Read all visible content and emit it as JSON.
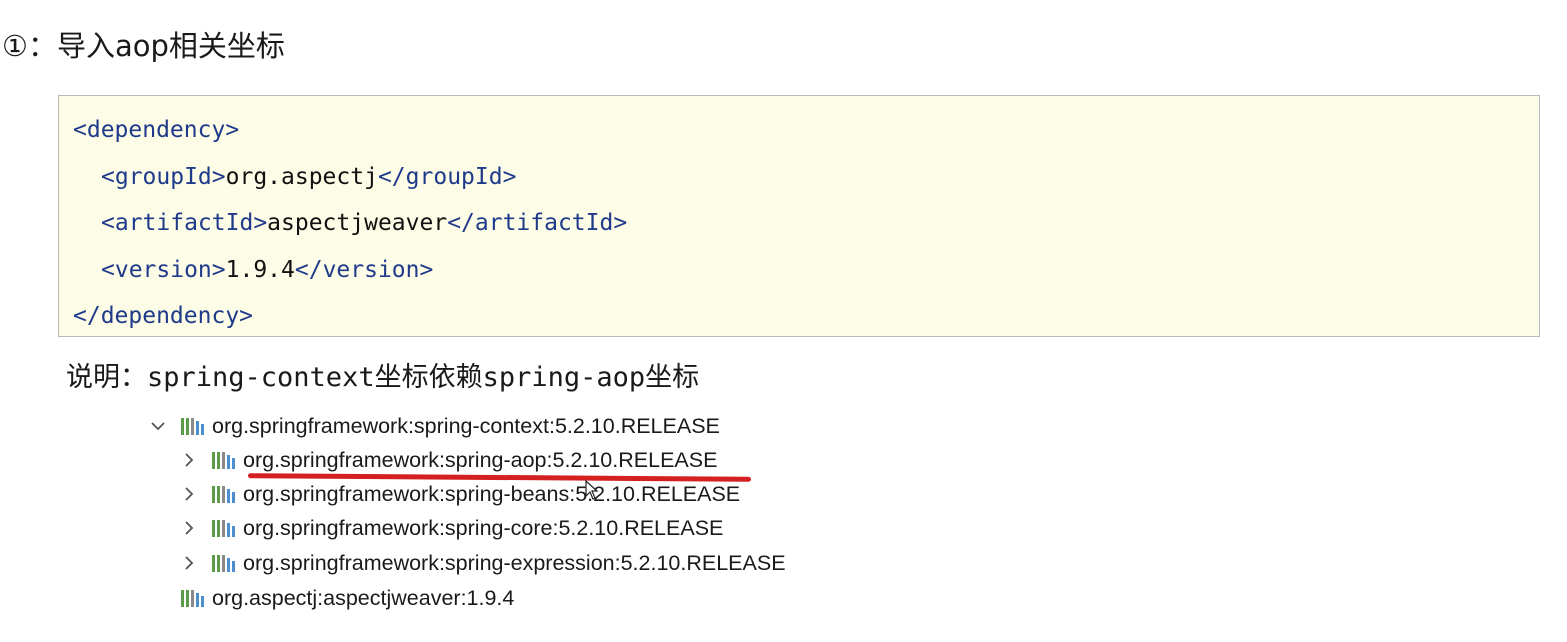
{
  "heading": {
    "number": "①",
    "text": "：导入aop相关坐标"
  },
  "code": {
    "open_tag": "<dependency>",
    "group_open": "<groupId>",
    "group_value": "org.aspectj",
    "group_close": "</groupId>",
    "artifact_open": "<artifactId>",
    "artifact_value": "aspectjweaver",
    "artifact_close": "</artifactId>",
    "version_open": "<version>",
    "version_value": "1.9.4",
    "version_close": "</version>",
    "close_tag": "</dependency>"
  },
  "note": {
    "prefix": "说明：",
    "part1": "spring-context",
    "part2": "坐标依赖",
    "part3": "spring-aop",
    "part4": "坐标"
  },
  "tree": {
    "root": "org.springframework:spring-context:5.2.10.RELEASE",
    "children": [
      "org.springframework:spring-aop:5.2.10.RELEASE",
      "org.springframework:spring-beans:5.2.10.RELEASE",
      "org.springframework:spring-core:5.2.10.RELEASE",
      "org.springframework:spring-expression:5.2.10.RELEASE"
    ],
    "sibling": "org.aspectj:aspectjweaver:1.9.4"
  },
  "colors": {
    "code_background": "#fdfce6",
    "tag_color": "#1f3a8a",
    "underline": "#d42020",
    "library_icon": [
      "#5b9b4a",
      "#8a8a8a",
      "#4a8fcf"
    ]
  }
}
